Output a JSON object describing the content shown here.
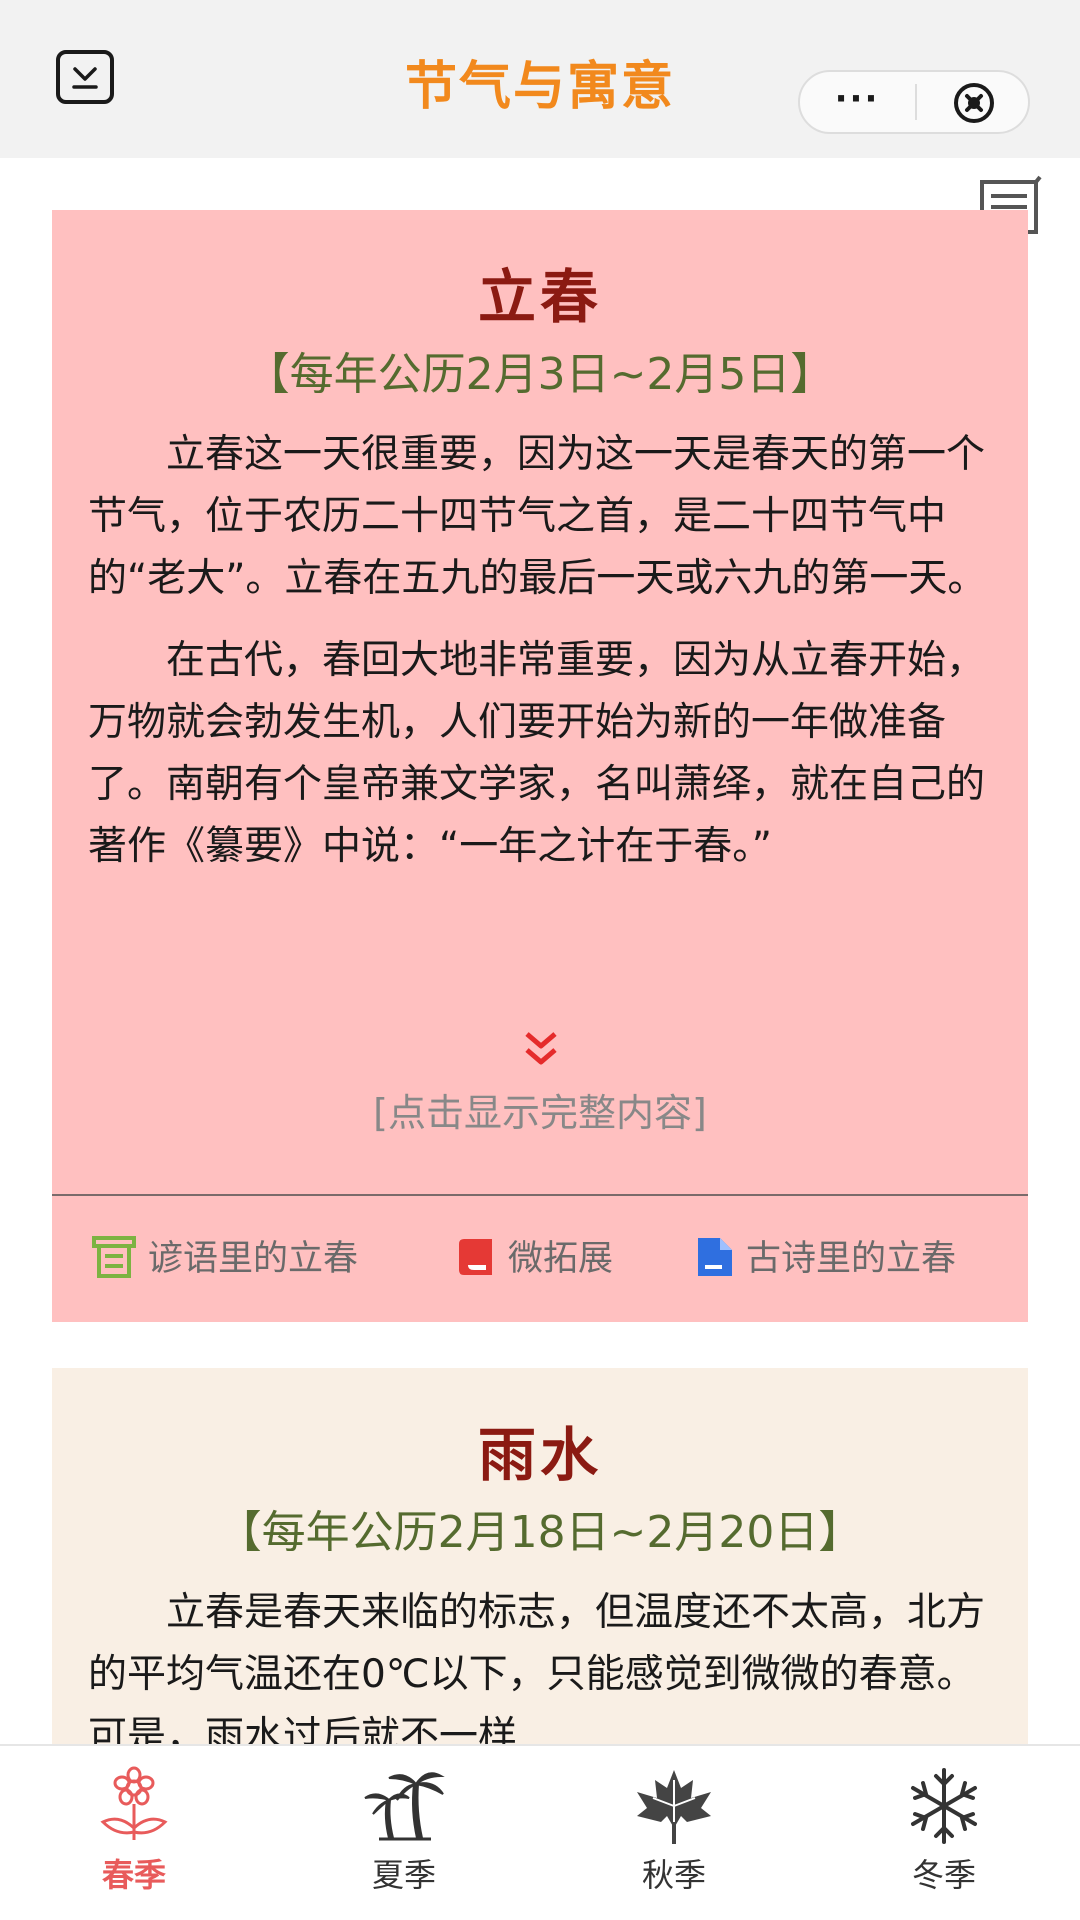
{
  "header": {
    "title": "节气与寓意",
    "more_label": "···"
  },
  "colors": {
    "title_orange": "#f2891d",
    "card1_bg": "#ffc0c0",
    "card2_bg": "#f9efe4",
    "card_title": "#8b1a12",
    "date_green": "#556b2f",
    "active_tab": "#e85b5b"
  },
  "cards": [
    {
      "title": "立春",
      "date": "【每年公历2月3日~2月5日】",
      "paragraphs": [
        "立春这一天很重要，因为这一天是春天的第一个节气，位于农历二十四节气之首，是二十四节气中的“老大”。立春在五九的最后一天或六九的第一天。",
        "在古代，春回大地非常重要，因为从立春开始，万物就会勃发生机，人们要开始为新的一年做准备了。南朝有个皇帝兼文学家，名叫萧绎，就在自己的著作《纂要》中说：“一年之计在于春。”"
      ],
      "expand_label": "[点击显示完整内容]",
      "links": [
        {
          "label": "谚语里的立春",
          "icon": "scroll-icon",
          "color": "#7cb342"
        },
        {
          "label": "微拓展",
          "icon": "book-icon",
          "color": "#e53935"
        },
        {
          "label": "古诗里的立春",
          "icon": "document-icon",
          "color": "#2f6fe0"
        }
      ]
    },
    {
      "title": "雨水",
      "date": "【每年公历2月18日~2月20日】",
      "paragraphs": [
        "立春是春天来临的标志，但温度还不太高，北方的平均气温还在0℃以下，只能感觉到微微的春意。可是，雨水过后就不一样"
      ]
    }
  ],
  "tabs": [
    {
      "label": "春季",
      "icon": "flower-icon",
      "active": true
    },
    {
      "label": "夏季",
      "icon": "palm-tree-icon",
      "active": false
    },
    {
      "label": "秋季",
      "icon": "maple-leaf-icon",
      "active": false
    },
    {
      "label": "冬季",
      "icon": "snowflake-icon",
      "active": false
    }
  ]
}
